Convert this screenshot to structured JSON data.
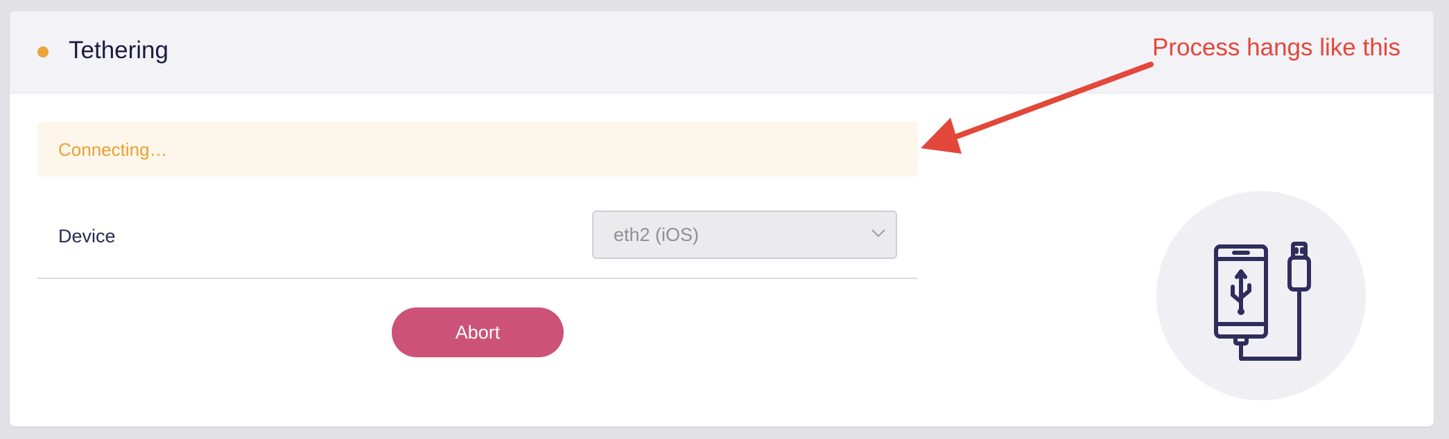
{
  "header": {
    "title": "Tethering",
    "status_color": "#eaa53a"
  },
  "alert": {
    "text": "Connecting…",
    "color": "#e8a232"
  },
  "form": {
    "device_label": "Device",
    "device_value": "eth2 (iOS)"
  },
  "actions": {
    "abort_label": "Abort"
  },
  "illustration": {
    "icon": "phone-usb-cable-icon"
  },
  "annotation": {
    "text": "Process hangs like this",
    "color": "#e2473a"
  }
}
